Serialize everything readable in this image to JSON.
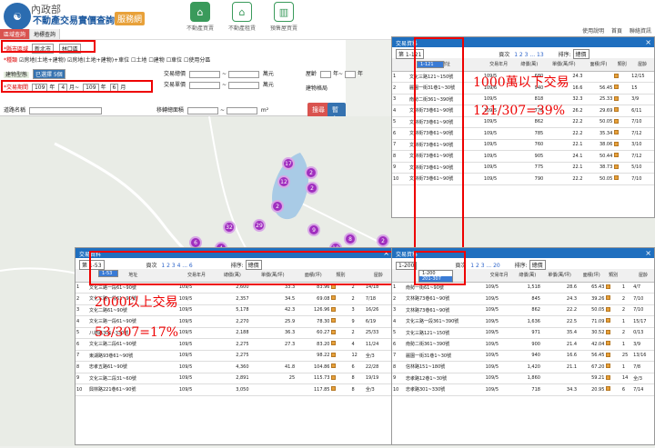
{
  "header": {
    "logo_l1": "內政部",
    "logo_l2": "不動產交易實價查詢",
    "logo_badge": "服務網",
    "nav": [
      {
        "label": "不動產買賣"
      },
      {
        "label": "不動產租賃"
      },
      {
        "label": "預售屋買賣"
      }
    ],
    "links": [
      "使用說明",
      "首頁",
      "聯絡資訊"
    ]
  },
  "side_tabs": [
    "區域查詢",
    "地標查詢"
  ],
  "search": {
    "county_label": "*縣市區域",
    "county": "新北市",
    "district": "林口區",
    "type_label": "*種類",
    "types": [
      "房地(土地+建物)",
      "房地(土地+建物)+車位",
      "土地",
      "建物",
      "車位",
      "使用分區"
    ],
    "building_label": "建物型態",
    "building_value": "已選擇 5個",
    "total_price_label": "交易總價",
    "unit_price_label": "交易單價",
    "wan": "萬元",
    "age_label": "屋齡",
    "age_unit": "年",
    "pattern_label": "建物格局",
    "period_label": "*交易期間",
    "from_y": "109",
    "from_m": "4",
    "to_y": "109",
    "to_m": "6",
    "y_unit": "年",
    "m_unit": "月",
    "road_label": "道路名稱",
    "area_label": "移轉總面積",
    "area_unit": "m²",
    "search_btn": "搜尋",
    "save_btn": "暫存搜尋"
  },
  "annotations": {
    "a1": "1000萬以下交易",
    "a2": "121/307=39%",
    "a3": "2000以上交易",
    "a4": "53/307=17%"
  },
  "clusters": [
    "17",
    "12",
    "2",
    "2",
    "32",
    "29",
    "2",
    "9",
    "8",
    "2",
    "6",
    "4",
    "10"
  ],
  "panel_title": "交易資料",
  "col_headers": [
    "地址",
    "交易年月",
    "總價(萬)",
    "單價(萬/坪)",
    "面積(坪)",
    "類別",
    "屋齡"
  ],
  "panel_right": {
    "range": "第 1-121",
    "popup": [
      "1-121"
    ],
    "page_label": "頁次",
    "pages": "1 2 3 ... 13",
    "sort_label": "排序:",
    "sort": "總價",
    "rows": [
      [
        "1",
        "文化三路121~150號",
        "109/5",
        "680",
        "24.3",
        "",
        "12/15"
      ],
      [
        "2",
        "麗園一街31巷1~30號",
        "109/6",
        "940",
        "16.6",
        "56.45",
        "15"
      ],
      [
        "3",
        "南勢二街361~390號",
        "109/5",
        "818",
        "32.3",
        "25.33",
        "3/9"
      ],
      [
        "4",
        "文林街73巷61~90號",
        "109/5",
        "778",
        "26.2",
        "29.69",
        "6/11"
      ],
      [
        "5",
        "文林街73巷61~90號",
        "109/5",
        "862",
        "22.2",
        "50.05",
        "7/10"
      ],
      [
        "6",
        "文林街73巷61~90號",
        "109/5",
        "785",
        "22.2",
        "35.34",
        "7/12"
      ],
      [
        "7",
        "文林街73巷61~90號",
        "109/5",
        "760",
        "22.1",
        "38.06",
        "3/10"
      ],
      [
        "8",
        "文林街73巷61~90號",
        "109/5",
        "905",
        "24.1",
        "50.44",
        "7/12"
      ],
      [
        "9",
        "文林街73巷61~90號",
        "109/5",
        "775",
        "22.1",
        "38.73",
        "5/10"
      ],
      [
        "10",
        "文林街73巷61~90號",
        "109/5",
        "790",
        "22.2",
        "50.05",
        "7/10"
      ]
    ]
  },
  "panel_left": {
    "range": "第 1-53",
    "popup": [
      "1-53"
    ],
    "page_label": "頁次",
    "pages": "1 2 3 4 ... 6",
    "sort_label": "排序:",
    "sort": "總價",
    "rows": [
      [
        "1",
        "文化三路一段61~90號",
        "109/5",
        "2,600",
        "33.3",
        "83.96",
        "2",
        "14/18"
      ],
      [
        "2",
        "文化三路一段61~90號",
        "109/5",
        "2,357",
        "34.5",
        "69.08",
        "2",
        "7/18"
      ],
      [
        "3",
        "文化二路61~90號",
        "109/5",
        "5,178",
        "42.3",
        "126.96",
        "3",
        "16/26"
      ],
      [
        "4",
        "文化三路一段61~90號",
        "109/5",
        "2,270",
        "25.9",
        "78.30",
        "9",
        "6/19"
      ],
      [
        "5",
        "八德路301~330號",
        "109/5",
        "2,188",
        "36.3",
        "60.27",
        "2",
        "25/33"
      ],
      [
        "6",
        "文化三路二段61~90號",
        "109/5",
        "2,275",
        "27.3",
        "83.20",
        "4",
        "11/24"
      ],
      [
        "7",
        "東湖路93巷61~90號",
        "109/5",
        "2,275",
        "",
        "98.22",
        "12",
        "全/3"
      ],
      [
        "8",
        "忠孝五路61~90號",
        "109/5",
        "4,360",
        "41.8",
        "104.86",
        "6",
        "22/28"
      ],
      [
        "9",
        "文化三路二段31~60號",
        "109/5",
        "2,891",
        "25",
        "115.73",
        "8",
        "19/19"
      ],
      [
        "10",
        "興林路221巷61~90號",
        "109/5",
        "3,050",
        "",
        "117.85",
        "8",
        "全/3"
      ]
    ]
  },
  "panel_br": {
    "range": "1-200",
    "popup": [
      "1-200",
      "201-307"
    ],
    "page_label": "頁次",
    "pages": "1 2 3 ... 20",
    "sort_label": "排序:",
    "sort": "總價",
    "rows": [
      [
        "1",
        "南勢一街61~90號",
        "109/5",
        "1,518",
        "28.6",
        "65.43",
        "1",
        "4/7"
      ],
      [
        "2",
        "文林路73巷61~90號",
        "109/5",
        "845",
        "24.3",
        "39.26",
        "2",
        "7/10"
      ],
      [
        "3",
        "文林路73巷61~90號",
        "109/5",
        "862",
        "22.2",
        "50.05",
        "2",
        "7/10"
      ],
      [
        "4",
        "文化三路一段361~390號",
        "109/5",
        "1,636",
        "22.5",
        "71.09",
        "1",
        "15/17"
      ],
      [
        "5",
        "文化三路121~150號",
        "109/5",
        "971",
        "35.4",
        "30.52",
        "2",
        "0/13"
      ],
      [
        "6",
        "南勢二街361~390號",
        "109/5",
        "900",
        "21.4",
        "42.04",
        "1",
        "3/9"
      ],
      [
        "7",
        "麗園一街31巷1~30號",
        "109/5",
        "940",
        "16.6",
        "56.45",
        "25",
        "13/16"
      ],
      [
        "8",
        "信林路151~180號",
        "109/5",
        "1,420",
        "21.1",
        "67.20",
        "1",
        "7/8"
      ],
      [
        "9",
        "忠孝路12巷1~30號",
        "109/5",
        "1,860",
        "",
        "59.21",
        "14",
        "全/3"
      ],
      [
        "10",
        "忠孝路301~330號",
        "109/5",
        "718",
        "34.3",
        "20.95",
        "6",
        "7/14"
      ]
    ]
  }
}
